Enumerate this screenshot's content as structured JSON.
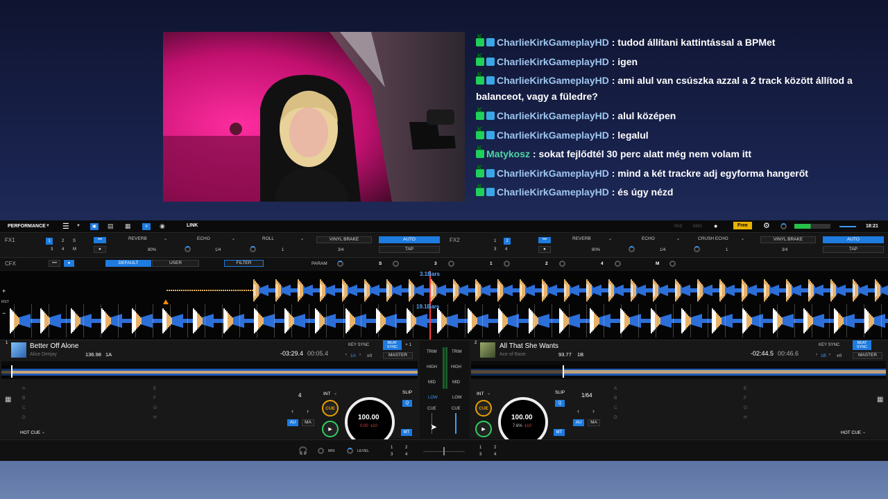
{
  "chat": [
    {
      "user": "CharlieKirkGameplayHD",
      "badges": [
        "k",
        "p"
      ],
      "text": ": tudod állítani kattintással a BPMet"
    },
    {
      "user": "CharlieKirkGameplayHD",
      "badges": [
        "k",
        "p"
      ],
      "text": ": igen"
    },
    {
      "user": "CharlieKirkGameplayHD",
      "badges": [
        "k",
        "p"
      ],
      "text": ": ami alul van csúszka azzal a 2 track között állítod a balanceot, vagy a füledre?"
    },
    {
      "user": "CharlieKirkGameplayHD",
      "badges": [
        "k",
        "p"
      ],
      "text": ": alul középen"
    },
    {
      "user": "CharlieKirkGameplayHD",
      "badges": [
        "k",
        "p"
      ],
      "text": ": legalul"
    },
    {
      "user": "Matykosz",
      "badges": [
        "k"
      ],
      "text": ": sokat fejlődtél 30 perc alatt még nem volam itt"
    },
    {
      "user": "CharlieKirkGameplayHD",
      "badges": [
        "k",
        "p"
      ],
      "text": ": mind a két trackre adj egyforma hangerőt"
    },
    {
      "user": "CharlieKirkGameplayHD",
      "badges": [
        "k",
        "p"
      ],
      "text": ": és úgy nézd"
    }
  ],
  "topbar": {
    "mode": "PERFORMANCE",
    "link": "LINK",
    "pad": "PAD",
    "midi": "MIDI",
    "free": "Free",
    "time": "18:21"
  },
  "fx1": {
    "label": "FX1",
    "slots": [
      "1",
      "2",
      "3",
      "4",
      "S",
      "M"
    ],
    "more": "•••",
    "effects": [
      "REVERB",
      "ECHO",
      "ROLL"
    ],
    "pct": "80%",
    "beat1": "1/4",
    "beat2": "1",
    "brake": "VINYL BRAKE",
    "brake_beat": "3/4",
    "auto": "AUTO",
    "tap": "TAP"
  },
  "fx2": {
    "label": "FX2",
    "slots": [
      "1",
      "2",
      "3",
      "4"
    ],
    "more": "•••",
    "effects": [
      "REVERB",
      "ECHO",
      "CRUSH ECHO"
    ],
    "pct": "80%",
    "beat1": "1/4",
    "beat2": "1",
    "brake": "VINYL BRAKE",
    "brake_beat": "3/4",
    "auto": "AUTO",
    "tap": "TAP"
  },
  "cfx": {
    "label": "CFX",
    "more": "•••",
    "default": "DEFAULT",
    "user": "USER",
    "filter": "FILTER",
    "param": "PARAM",
    "keys": [
      "S",
      "3",
      "1",
      "2",
      "4",
      "M"
    ]
  },
  "waveform": {
    "bars1": "3.1Bars",
    "bars2": "19.1Bars",
    "zoom_in": "+",
    "rst": "RST",
    "zoom_out": "−"
  },
  "deck1": {
    "num": "1",
    "title": "Better Off Alone",
    "artist": "Alice Deejay",
    "bpm": "136.98",
    "key": "1A",
    "remaining": "-03:29.4",
    "elapsed": "00:05.4",
    "keysync": "KEY SYNC",
    "beatsync": "BEAT SYNC",
    "x1": "× 1",
    "keyval": "1A",
    "keyoff": "±0",
    "master": "MASTER",
    "pads_left": [
      "A",
      "B",
      "C",
      "D"
    ],
    "pads_right": [
      "E",
      "F",
      "G",
      "H"
    ],
    "hotcue": "HOT CUE",
    "loop": "4",
    "int": "INT",
    "cue": "CUE",
    "play": "▶",
    "au": "AU",
    "ma": "MA",
    "slip": "SLIP",
    "q": "Q",
    "mt": "MT",
    "tempo": "100.00",
    "tempo_sub": "0.00",
    "tempo_range": "±10"
  },
  "deck2": {
    "num": "2",
    "title": "All That She Wants",
    "artist": "Ace of Base",
    "bpm": "93.77",
    "key": "1B",
    "remaining": "-02:44.5",
    "elapsed": "00:46.6",
    "keysync": "KEY SYNC",
    "beatsync": "BEAT SYNC",
    "keyval": "1B",
    "keyoff": "±0",
    "master": "MASTER",
    "pads_left": [
      "A",
      "B",
      "C",
      "D"
    ],
    "pads_right": [
      "E",
      "F",
      "G",
      "H"
    ],
    "hotcue": "HOT CUE",
    "loop": "1/64",
    "int": "INT",
    "cue": "CUE",
    "play": "▶",
    "au": "AU",
    "ma": "MA",
    "slip": "SLIP",
    "q": "Q",
    "mt": "MT",
    "tempo": "100.00",
    "tempo_sub": "7.6%",
    "tempo_range": "±10"
  },
  "mixer": {
    "trim": "TRIM",
    "high": "HIGH",
    "mid": "MID",
    "low": "LOW",
    "cue": "CUE"
  },
  "footer": {
    "mix": "MIX",
    "level": "LEVEL",
    "nums": [
      "1",
      "2",
      "3",
      "4"
    ]
  }
}
